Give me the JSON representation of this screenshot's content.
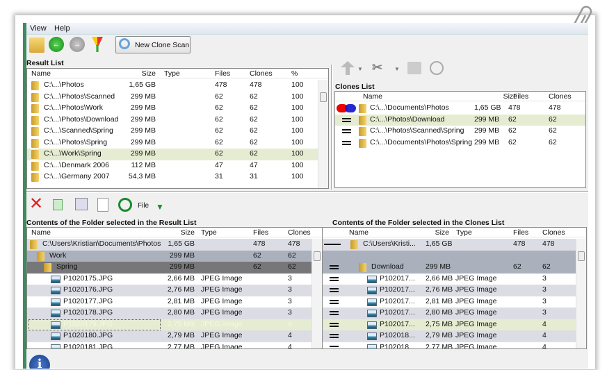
{
  "menu": [
    "View",
    "Help"
  ],
  "toolbar": {
    "new_scan": "New Clone Scan",
    "icons": [
      "open-folder-icon",
      "back-icon",
      "forward-icon",
      "filter-icon",
      "magnifier-icon"
    ]
  },
  "result_list": {
    "title": "Result List",
    "columns": [
      "Name",
      "Size",
      "Type",
      "Files",
      "Clones",
      "%"
    ],
    "rows": [
      [
        "C:\\...\\Photos",
        "1,65 GB",
        "",
        "478",
        "478",
        "100"
      ],
      [
        "C:\\...\\Photos\\Scanned",
        "299 MB",
        "",
        "62",
        "62",
        "100"
      ],
      [
        "C:\\...\\Photos\\Work",
        "299 MB",
        "",
        "62",
        "62",
        "100"
      ],
      [
        "C:\\...\\Photos\\Download",
        "299 MB",
        "",
        "62",
        "62",
        "100"
      ],
      [
        "C:\\...\\Scanned\\Spring",
        "299 MB",
        "",
        "62",
        "62",
        "100"
      ],
      [
        "C:\\...\\Photos\\Spring",
        "299 MB",
        "",
        "62",
        "62",
        "100"
      ],
      [
        "C:\\...\\Work\\Spring",
        "299 MB",
        "",
        "62",
        "62",
        "100"
      ],
      [
        "C:\\...\\Denmark 2006",
        "112 MB",
        "",
        "47",
        "47",
        "100"
      ],
      [
        "C:\\...\\Germany 2007",
        "54,3 MB",
        "",
        "31",
        "31",
        "100"
      ]
    ],
    "selected_index": 6
  },
  "clones_list": {
    "title": "Clones List",
    "columns": [
      "Name",
      "Size",
      "Files",
      "Clones"
    ],
    "rows": [
      [
        "C:\\...\\Documents\\Photos",
        "1,65 GB",
        "478",
        "478"
      ],
      [
        "C:\\...\\Photos\\Download",
        "299 MB",
        "62",
        "62"
      ],
      [
        "C:\\...\\Photos\\Scanned\\Spring",
        "299 MB",
        "62",
        "62"
      ],
      [
        "C:\\...\\Documents\\Photos\\Spring",
        "299 MB",
        "62",
        "62"
      ]
    ],
    "selected_index": 1
  },
  "lower_toolbar": {
    "file_label": "File"
  },
  "left_contents": {
    "title": "Contents of the Folder selected in the Result List",
    "columns": [
      "Name",
      "Size",
      "Type",
      "Files",
      "Clones"
    ],
    "rows": [
      {
        "kind": "folder",
        "level": 0,
        "cells": [
          "C:\\Users\\Kristian\\Documents\\Photos",
          "1,65 GB",
          "",
          "478",
          "478"
        ]
      },
      {
        "kind": "folder",
        "level": 1,
        "cells": [
          "Work",
          "299 MB",
          "",
          "62",
          "62"
        ]
      },
      {
        "kind": "folder",
        "level": 2,
        "cells": [
          "Spring",
          "299 MB",
          "",
          "62",
          "62"
        ]
      },
      {
        "kind": "file",
        "level": 3,
        "cells": [
          "P1020175.JPG",
          "2,66 MB",
          "JPEG Image",
          "",
          "3"
        ]
      },
      {
        "kind": "file",
        "level": 3,
        "cells": [
          "P1020176.JPG",
          "2,76 MB",
          "JPEG Image",
          "",
          "3"
        ]
      },
      {
        "kind": "file",
        "level": 3,
        "cells": [
          "P1020177.JPG",
          "2,81 MB",
          "JPEG Image",
          "",
          "3"
        ]
      },
      {
        "kind": "file",
        "level": 3,
        "cells": [
          "P1020178.JPG",
          "2,80 MB",
          "JPEG Image",
          "",
          "3"
        ]
      },
      {
        "kind": "file",
        "level": 3,
        "cells": [
          "P1020179.JPG",
          "2,75 MB",
          "JPEG Image",
          "",
          "4"
        ]
      },
      {
        "kind": "file",
        "level": 3,
        "cells": [
          "P1020180.JPG",
          "2,79 MB",
          "JPEG Image",
          "",
          "4"
        ]
      },
      {
        "kind": "file",
        "level": 3,
        "cells": [
          "P1020181.JPG",
          "2,77 MB",
          "JPEG Image",
          "",
          "4"
        ]
      }
    ],
    "selected_index": 7
  },
  "right_contents": {
    "title": "Contents of the Folder selected in the Clones List",
    "columns": [
      "Name",
      "Size",
      "Type",
      "Files",
      "Clones"
    ],
    "rows": [
      {
        "kind": "folder",
        "level": 0,
        "cells": [
          "C:\\Users\\Kristi...",
          "1,65 GB",
          "",
          "478",
          "478"
        ]
      },
      {
        "kind": "blank",
        "level": 1,
        "cells": [
          "",
          "",
          "",
          "",
          ""
        ]
      },
      {
        "kind": "folder",
        "level": 1,
        "cells": [
          "Download",
          "299 MB",
          "",
          "62",
          "62"
        ]
      },
      {
        "kind": "file",
        "level": 2,
        "cells": [
          "P102017...",
          "2,66 MB",
          "JPEG Image",
          "",
          "3"
        ]
      },
      {
        "kind": "file",
        "level": 2,
        "cells": [
          "P102017...",
          "2,76 MB",
          "JPEG Image",
          "",
          "3"
        ]
      },
      {
        "kind": "file",
        "level": 2,
        "cells": [
          "P102017...",
          "2,81 MB",
          "JPEG Image",
          "",
          "3"
        ]
      },
      {
        "kind": "file",
        "level": 2,
        "cells": [
          "P102017...",
          "2,80 MB",
          "JPEG Image",
          "",
          "3"
        ]
      },
      {
        "kind": "file",
        "level": 2,
        "cells": [
          "P102017...",
          "2,75 MB",
          "JPEG Image",
          "",
          "4"
        ]
      },
      {
        "kind": "file",
        "level": 2,
        "cells": [
          "P102018...",
          "2,79 MB",
          "JPEG Image",
          "",
          "4"
        ]
      },
      {
        "kind": "file",
        "level": 2,
        "cells": [
          "P102018...",
          "2,77 MB",
          "JPEG Image",
          "",
          "4"
        ]
      }
    ],
    "selected_index": 7
  }
}
